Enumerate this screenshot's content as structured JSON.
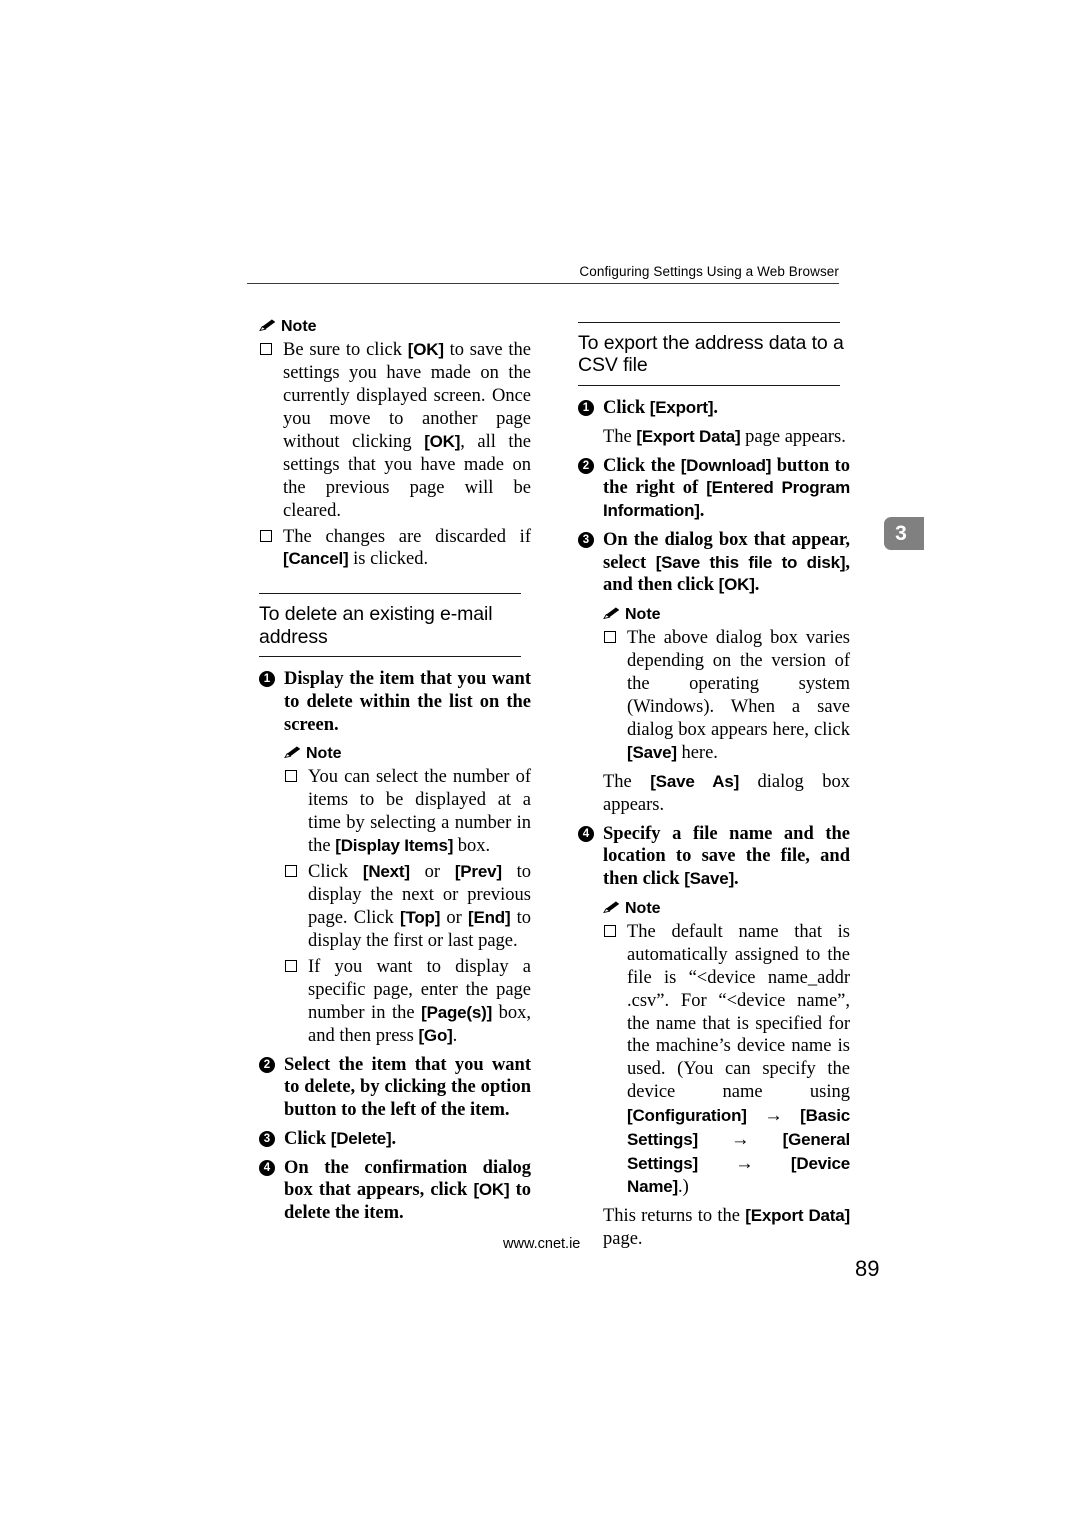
{
  "header": {
    "running_title": "Configuring Settings Using a Web Browser"
  },
  "chapter_tab": {
    "number": "3",
    "color": "#808080"
  },
  "left_column": {
    "note1": {
      "label": "Note",
      "items": [
        {
          "parts": [
            {
              "t": "Be sure to click ",
              "s": "roman"
            },
            {
              "t": "[OK]",
              "s": "ui"
            },
            {
              "t": " to save the settings you have made on the currently displayed screen. Once you move to another page without clicking ",
              "s": "roman"
            },
            {
              "t": "[OK]",
              "s": "ui"
            },
            {
              "t": ", all the settings that you have made on the previous page will be cleared.",
              "s": "roman"
            }
          ]
        },
        {
          "parts": [
            {
              "t": "The changes are discarded if ",
              "s": "roman"
            },
            {
              "t": "[Cancel]",
              "s": "ui"
            },
            {
              "t": " is clicked.",
              "s": "roman"
            }
          ]
        }
      ]
    },
    "section": {
      "title": "To delete an existing e-mail address"
    },
    "step1": {
      "number": "1",
      "parts": [
        {
          "t": "Display the item that you want to delete within the list on the screen.",
          "s": "bold"
        }
      ]
    },
    "note2": {
      "label": "Note",
      "items": [
        {
          "parts": [
            {
              "t": "You can select the number of items to be displayed at a time by selecting a number in the ",
              "s": "roman"
            },
            {
              "t": "[Display Items]",
              "s": "ui"
            },
            {
              "t": " box.",
              "s": "roman"
            }
          ]
        },
        {
          "parts": [
            {
              "t": "Click ",
              "s": "roman"
            },
            {
              "t": "[Next]",
              "s": "ui"
            },
            {
              "t": " or ",
              "s": "roman"
            },
            {
              "t": "[Prev]",
              "s": "ui"
            },
            {
              "t": " to display the next or previous page. Click ",
              "s": "roman"
            },
            {
              "t": "[Top]",
              "s": "ui"
            },
            {
              "t": " or ",
              "s": "roman"
            },
            {
              "t": "[End]",
              "s": "ui"
            },
            {
              "t": " to display the first or last page.",
              "s": "roman"
            }
          ]
        },
        {
          "parts": [
            {
              "t": "If you want to display a specific page, enter the page number in the ",
              "s": "roman"
            },
            {
              "t": "[Page(s)]",
              "s": "ui"
            },
            {
              "t": " box, and then press ",
              "s": "roman"
            },
            {
              "t": "[Go]",
              "s": "ui"
            },
            {
              "t": ".",
              "s": "roman"
            }
          ]
        }
      ]
    },
    "step2": {
      "number": "2",
      "parts": [
        {
          "t": "Select the item that you want to delete, by clicking the option button to the left of the item.",
          "s": "bold"
        }
      ]
    },
    "step3": {
      "number": "3",
      "parts": [
        {
          "t": "Click ",
          "s": "bold"
        },
        {
          "t": "[Delete]",
          "s": "ui"
        },
        {
          "t": ".",
          "s": "bold"
        }
      ]
    },
    "step4": {
      "number": "4",
      "parts": [
        {
          "t": "On the confirmation dialog box that appears, click ",
          "s": "bold"
        },
        {
          "t": "[OK]",
          "s": "ui"
        },
        {
          "t": " to delete the item.",
          "s": "bold"
        }
      ]
    }
  },
  "right_column": {
    "section": {
      "title": "To export the address data to a CSV file"
    },
    "step1": {
      "number": "1",
      "parts": [
        {
          "t": "Click ",
          "s": "bold"
        },
        {
          "t": "[Export]",
          "s": "ui"
        },
        {
          "t": ".",
          "s": "bold"
        }
      ]
    },
    "para1": {
      "parts": [
        {
          "t": "The ",
          "s": "roman"
        },
        {
          "t": "[Export Data]",
          "s": "ui"
        },
        {
          "t": " page appears.",
          "s": "roman"
        }
      ]
    },
    "step2": {
      "number": "2",
      "parts": [
        {
          "t": "Click the ",
          "s": "bold"
        },
        {
          "t": "[Download]",
          "s": "ui"
        },
        {
          "t": " button to the right of ",
          "s": "bold"
        },
        {
          "t": "[Entered Program Information]",
          "s": "ui"
        },
        {
          "t": ".",
          "s": "bold"
        }
      ]
    },
    "step3": {
      "number": "3",
      "parts": [
        {
          "t": "On the dialog box that appear, select ",
          "s": "bold"
        },
        {
          "t": "[Save this file to disk]",
          "s": "ui"
        },
        {
          "t": ", and then click ",
          "s": "bold"
        },
        {
          "t": "[OK]",
          "s": "ui"
        },
        {
          "t": ".",
          "s": "bold"
        }
      ]
    },
    "note1": {
      "label": "Note",
      "items": [
        {
          "parts": [
            {
              "t": "The above dialog box varies depending on the version of the operating system (Windows). When a save dialog box appears here, click ",
              "s": "roman"
            },
            {
              "t": "[Save]",
              "s": "ui"
            },
            {
              "t": " here.",
              "s": "roman"
            }
          ]
        }
      ]
    },
    "para2": {
      "parts": [
        {
          "t": "The ",
          "s": "roman"
        },
        {
          "t": "[Save As]",
          "s": "ui"
        },
        {
          "t": " dialog box appears.",
          "s": "roman"
        }
      ]
    },
    "step4": {
      "number": "4",
      "parts": [
        {
          "t": "Specify a file name and the location to save the file, and then click ",
          "s": "bold"
        },
        {
          "t": "[Save]",
          "s": "ui"
        },
        {
          "t": ".",
          "s": "bold"
        }
      ]
    },
    "note2": {
      "label": "Note",
      "items": [
        {
          "parts": [
            {
              "t": "The default name that is automatically assigned to the file is “<device name_addr .csv”. For “<device name”, the name that is specified for the machine’s device name is used. (You can specify the device name using ",
              "s": "roman"
            },
            {
              "t": "[Configuration]",
              "s": "ui"
            },
            {
              "t": " → ",
              "s": "arrow"
            },
            {
              "t": "[Basic Settings]",
              "s": "ui"
            },
            {
              "t": " → ",
              "s": "arrow"
            },
            {
              "t": "[General Settings]",
              "s": "ui"
            },
            {
              "t": " → ",
              "s": "arrow"
            },
            {
              "t": "[Device Name]",
              "s": "ui"
            },
            {
              "t": ".)",
              "s": "roman"
            }
          ]
        }
      ]
    },
    "para3": {
      "parts": [
        {
          "t": "This returns to the ",
          "s": "roman"
        },
        {
          "t": "[Export Data]",
          "s": "ui"
        },
        {
          "t": " page.",
          "s": "roman"
        }
      ]
    }
  },
  "footer": {
    "url": "www.cnet.ie",
    "page_number": "89"
  }
}
